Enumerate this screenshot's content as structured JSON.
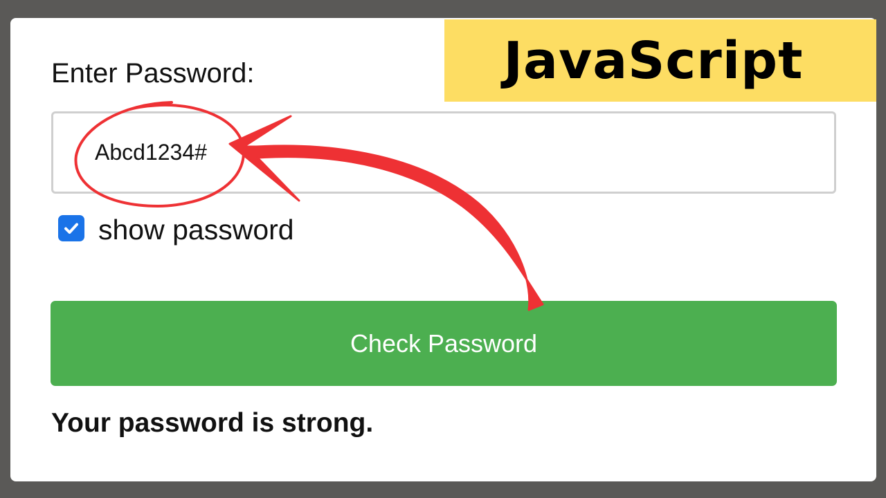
{
  "banner": {
    "title": "JavaScript",
    "bg_color": "#fddd63"
  },
  "form": {
    "label": "Enter Password:",
    "password_value": "Abcd1234#",
    "show_password_label": "show password",
    "show_password_checked": true,
    "check_button_label": "Check Password",
    "result_text": "Your password is strong."
  },
  "colors": {
    "button_green": "#4caf50",
    "checkbox_blue": "#1a73e8",
    "annotation_red": "#ee3134"
  },
  "icons": {
    "checkbox": "check-icon",
    "annotation_arrow": "curved-arrow-icon",
    "annotation_circle": "hand-drawn-circle"
  }
}
